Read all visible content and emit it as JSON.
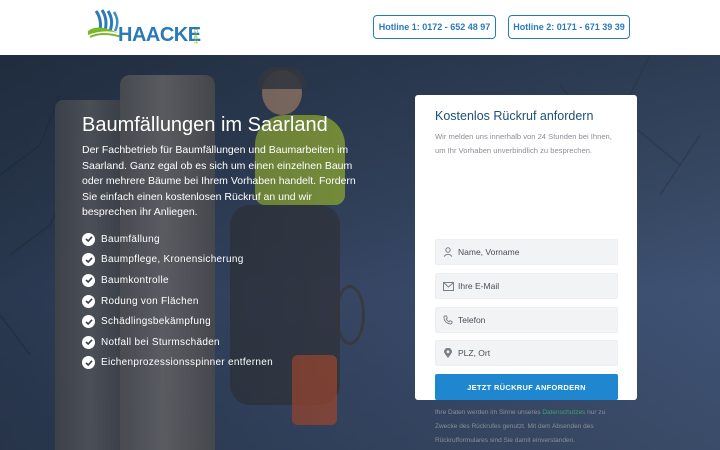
{
  "header": {
    "logo": {
      "text_main": "HAACKE",
      "text_sub": "GmbH"
    },
    "hotline1": "Hotline 1: 0172 - 652 48 97",
    "hotline2": "Hotline 2: 0171 - 671 39 39"
  },
  "hero": {
    "title": "Baumfällungen im Saarland",
    "text": "Der Fachbetrieb für Baumfällungen und Baumarbeiten im Saarland. Ganz egal ob es sich um einen einzelnen Baum oder mehrere Bäume bei Ihrem Vorhaben handelt. Fordern Sie einfach einen kostenlosen Rückruf an und wir besprechen ihr Anliegen.",
    "features": [
      "Baumfällung",
      "Baumpflege, Kronensicherung",
      "Baumkontrolle",
      "Rodung von Flächen",
      "Schädlingsbekämpfung",
      "Notfall bei Sturmschäden",
      "Eichenprozessionsspinner entfernen"
    ]
  },
  "form": {
    "title": "Kostenlos Rückruf anfordern",
    "description": "Wir melden uns innerhalb von 24 Stunden bei Ihnen, um Ihr Vorhaben unverbindlich zu besprechen.",
    "fields": {
      "name_placeholder": "Name, Vorname",
      "email_placeholder": "Ihre E-Mail",
      "phone_placeholder": "Telefon",
      "city_placeholder": "PLZ, Ort"
    },
    "submit": "JETZT RÜCKRUF ANFORDERN",
    "privacy_before": "Ihre Daten werden im Sinne unseres ",
    "privacy_link": "Datenschutzes",
    "privacy_after": " nur zu Zwecke des Rückrufes genutzt. Mit dem Absenden des Rückrufformulares sind Sie damit einverstanden."
  },
  "colors": {
    "brand_blue": "#2a7ab8",
    "brand_green": "#7ab82a",
    "button_blue": "#1e87cf",
    "form_title": "#1f4e79"
  },
  "icons": [
    "logo-swoosh-icon",
    "check-icon",
    "user-icon",
    "mail-icon",
    "phone-icon",
    "location-pin-icon"
  ]
}
